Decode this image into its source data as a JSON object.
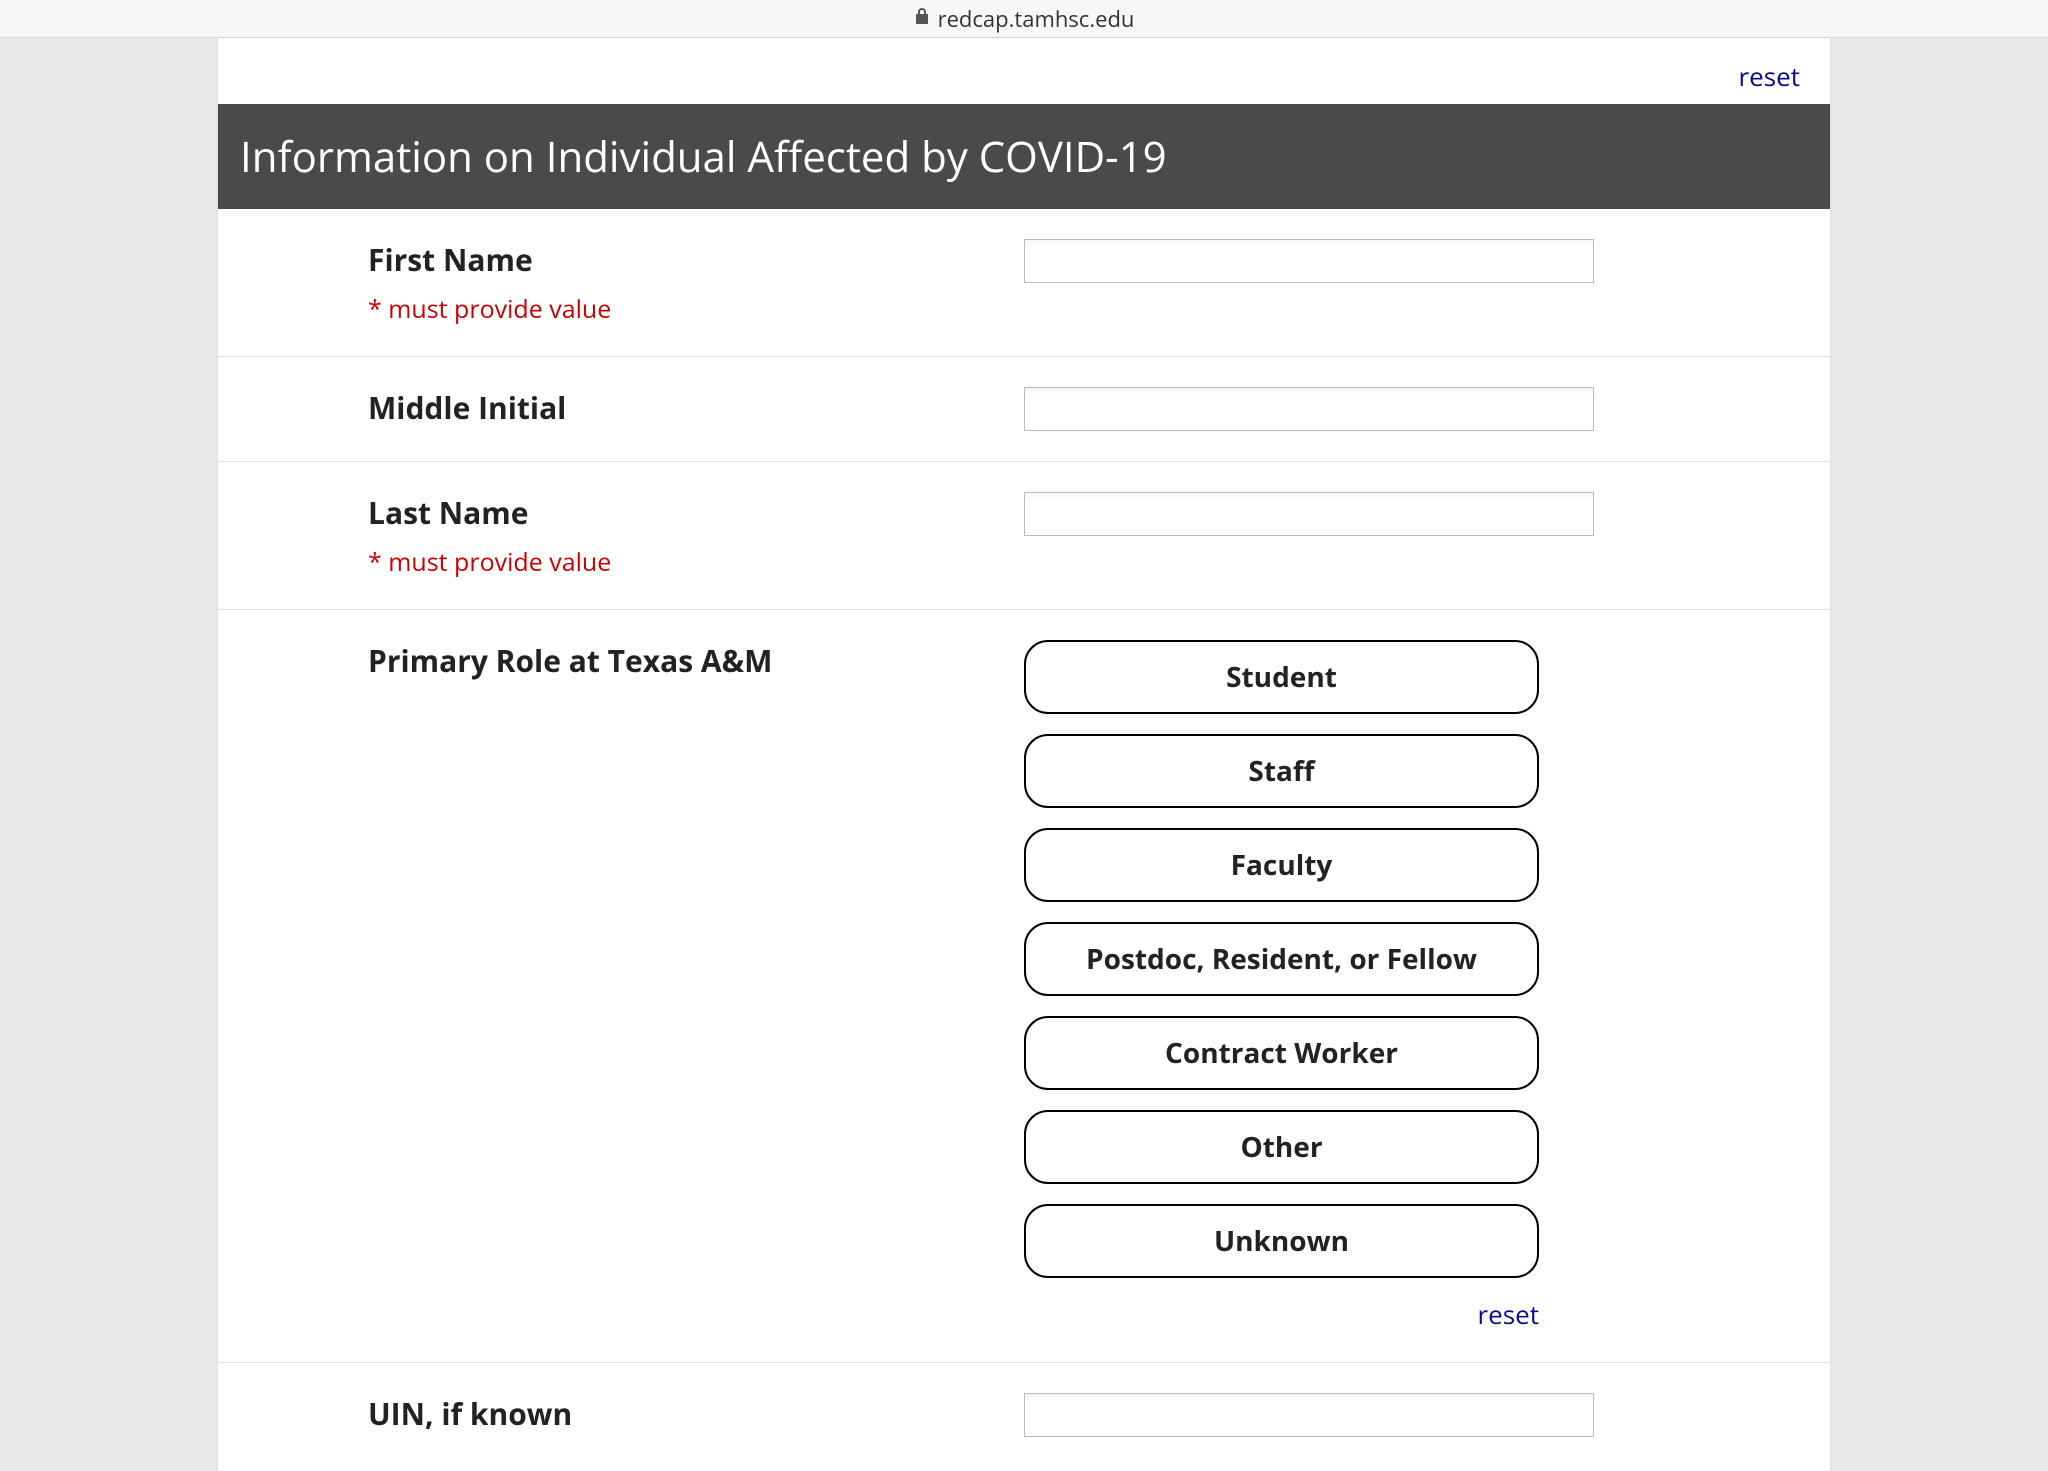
{
  "url_bar": {
    "domain": "redcap.tamhsc.edu"
  },
  "reset_top": "reset",
  "section_header": "Information on Individual Affected by COVID-19",
  "fields": {
    "first_name": {
      "label": "First Name",
      "required_text": "* must provide value"
    },
    "middle_initial": {
      "label": "Middle Initial"
    },
    "last_name": {
      "label": "Last Name",
      "required_text": "* must provide value"
    },
    "primary_role": {
      "label": "Primary Role at Texas A&M",
      "options": [
        "Student",
        "Staff",
        "Faculty",
        "Postdoc, Resident, or Fellow",
        "Contract Worker",
        "Other",
        "Unknown"
      ],
      "reset": "reset"
    },
    "uin": {
      "label": "UIN, if known"
    }
  }
}
